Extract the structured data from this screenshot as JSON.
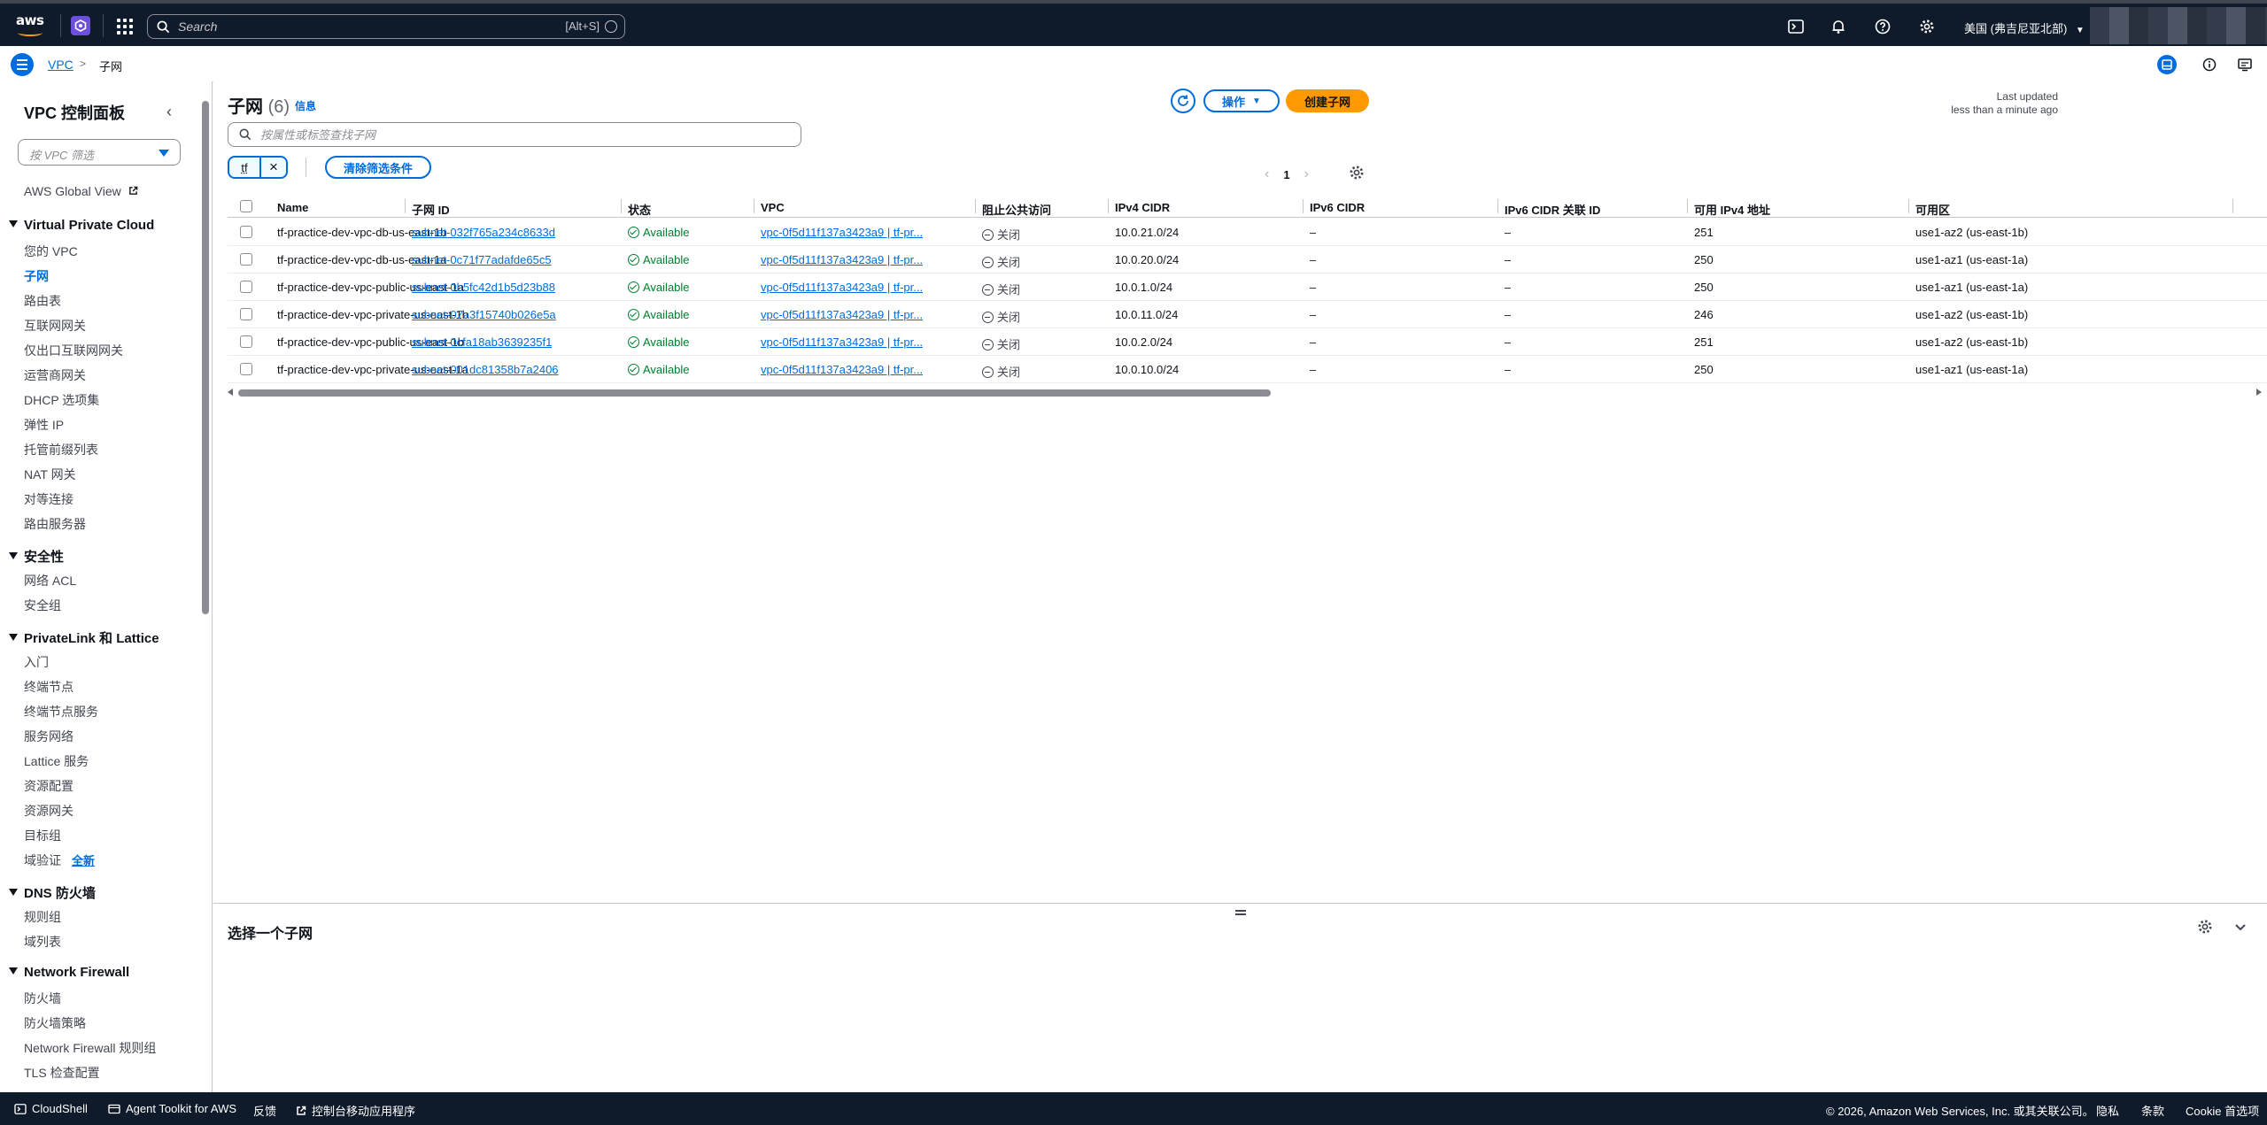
{
  "topnav": {
    "logo_text": "aws",
    "search_placeholder": "Search",
    "search_shortcut": "[Alt+S]",
    "region": "美国 (弗吉尼亚北部)"
  },
  "breadcrumb": {
    "service": "VPC",
    "current": "子网"
  },
  "sidenav": {
    "title": "VPC 控制面板",
    "filter_placeholder": "按 VPC 筛选",
    "global_view": "AWS Global View",
    "sections": {
      "vpc": {
        "title": "Virtual Private Cloud",
        "items": [
          "您的 VPC",
          "子网",
          "路由表",
          "互联网网关",
          "仅出口互联网网关",
          "运营商网关",
          "DHCP 选项集",
          "弹性 IP",
          "托管前缀列表",
          "NAT 网关",
          "对等连接",
          "路由服务器"
        ]
      },
      "security": {
        "title": "安全性",
        "items": [
          "网络 ACL",
          "安全组"
        ]
      },
      "privatelink": {
        "title": "PrivateLink 和 Lattice",
        "items": [
          "入门",
          "终端节点",
          "终端节点服务",
          "服务网络",
          "Lattice 服务",
          "资源配置",
          "资源网关",
          "目标组",
          "域验证"
        ],
        "new_badge": "全新"
      },
      "dns": {
        "title": "DNS 防火墙",
        "items": [
          "规则组",
          "域列表"
        ]
      },
      "firewall": {
        "title": "Network Firewall",
        "items": [
          "防火墙",
          "防火墙策略",
          "Network Firewall 规则组",
          "TLS 检查配置"
        ]
      }
    }
  },
  "main": {
    "title": "子网",
    "count": "(6)",
    "info": "信息",
    "last_updated_label": "Last updated",
    "last_updated_value": "less than a minute ago",
    "actions_label": "操作",
    "create_label": "创建子网",
    "search_placeholder": "按属性或标签查找子网",
    "filter_token": "tf",
    "clear_filters": "清除筛选条件",
    "page": "1",
    "columns": [
      "Name",
      "子网 ID",
      "状态",
      "VPC",
      "阻止公共访问",
      "IPv4 CIDR",
      "IPv6 CIDR",
      "IPv6 CIDR 关联 ID",
      "可用 IPv4 地址",
      "可用区"
    ],
    "rows": [
      {
        "name": "tf-practice-dev-vpc-db-us-east-1b",
        "subnet_id": "subnet-032f765a234c8633d",
        "status": "Available",
        "vpc": "vpc-0f5d11f137a3423a9 | tf-pr...",
        "bpa": "关闭",
        "ipv4": "10.0.21.0/24",
        "ipv6": "–",
        "ipv6_assoc": "–",
        "avail_ip": "251",
        "az": "use1-az2 (us-east-1b)"
      },
      {
        "name": "tf-practice-dev-vpc-db-us-east-1a",
        "subnet_id": "subnet-0c71f77adafde65c5",
        "status": "Available",
        "vpc": "vpc-0f5d11f137a3423a9 | tf-pr...",
        "bpa": "关闭",
        "ipv4": "10.0.20.0/24",
        "ipv6": "–",
        "ipv6_assoc": "–",
        "avail_ip": "250",
        "az": "use1-az1 (us-east-1a)"
      },
      {
        "name": "tf-practice-dev-vpc-public-us-east-1a",
        "subnet_id": "subnet-0b5fc42d1b5d23b88",
        "status": "Available",
        "vpc": "vpc-0f5d11f137a3423a9 | tf-pr...",
        "bpa": "关闭",
        "ipv4": "10.0.1.0/24",
        "ipv6": "–",
        "ipv6_assoc": "–",
        "avail_ip": "250",
        "az": "use1-az1 (us-east-1a)"
      },
      {
        "name": "tf-practice-dev-vpc-private-us-east-1b",
        "subnet_id": "subnet-07a3f15740b026e5a",
        "status": "Available",
        "vpc": "vpc-0f5d11f137a3423a9 | tf-pr...",
        "bpa": "关闭",
        "ipv4": "10.0.11.0/24",
        "ipv6": "–",
        "ipv6_assoc": "–",
        "avail_ip": "246",
        "az": "use1-az2 (us-east-1b)"
      },
      {
        "name": "tf-practice-dev-vpc-public-us-east-1b",
        "subnet_id": "subnet-0cfa18ab3639235f1",
        "status": "Available",
        "vpc": "vpc-0f5d11f137a3423a9 | tf-pr...",
        "bpa": "关闭",
        "ipv4": "10.0.2.0/24",
        "ipv6": "–",
        "ipv6_assoc": "–",
        "avail_ip": "251",
        "az": "use1-az2 (us-east-1b)"
      },
      {
        "name": "tf-practice-dev-vpc-private-us-east-1a",
        "subnet_id": "subnet-001dc81358b7a2406",
        "status": "Available",
        "vpc": "vpc-0f5d11f137a3423a9 | tf-pr...",
        "bpa": "关闭",
        "ipv4": "10.0.10.0/24",
        "ipv6": "–",
        "ipv6_assoc": "–",
        "avail_ip": "250",
        "az": "use1-az1 (us-east-1a)"
      }
    ]
  },
  "split_panel": {
    "title": "选择一个子网"
  },
  "footer": {
    "cloudshell": "CloudShell",
    "agent_toolkit": "Agent Toolkit for AWS",
    "feedback": "反馈",
    "mobile_app": "控制台移动应用程序",
    "copyright": "© 2026, Amazon Web Services, Inc. 或其关联公司。",
    "privacy": "隐私",
    "terms": "条款",
    "cookie": "Cookie 首选项"
  },
  "colors": {
    "nav_bg": "#0f1b2a",
    "link": "#006ce0",
    "primary_button": "#ff9900",
    "success": "#00802f"
  }
}
